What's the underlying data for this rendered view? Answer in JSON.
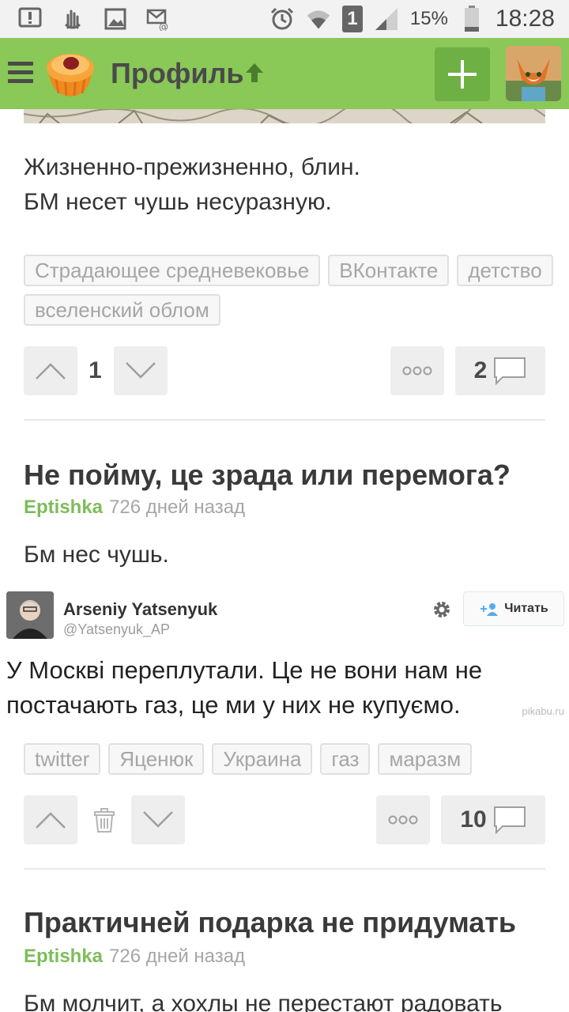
{
  "status_bar": {
    "sim_number": "1",
    "battery_percent": "15%",
    "time": "18:28"
  },
  "app_bar": {
    "title": "Профиль",
    "colors": {
      "bar": "#8ac858",
      "button": "#6fb045"
    }
  },
  "posts": [
    {
      "lines": [
        "Жизненно-прежизненно, блин.",
        "БМ несет чушь несуразную."
      ],
      "tags": [
        "Страдающее средневековье",
        "ВКонтакте",
        "детство",
        "вселенский облом"
      ],
      "rating": "1",
      "comments": "2"
    },
    {
      "title": "Не пойму, це зрада или перемога?",
      "author": "Eptishka",
      "time": "726 дней назад",
      "text": "Бм нес чушь.",
      "tweet": {
        "name": "Arseniy Yatsenyuk",
        "handle": "@Yatsenyuk_AP",
        "follow_label": "Читать",
        "text": "У Москві переплутали. Це не вони нам не постачають газ, це ми у них не купуємо.",
        "watermark": "pikabu.ru"
      },
      "tags": [
        "twitter",
        "Яценюк",
        "Украина",
        "газ",
        "маразм"
      ],
      "comments": "10"
    },
    {
      "title": "Практичней подарка не придумать",
      "author": "Eptishka",
      "time": "726 дней назад",
      "text": "Бм молчит, а хохлы не перестают радовать"
    }
  ]
}
